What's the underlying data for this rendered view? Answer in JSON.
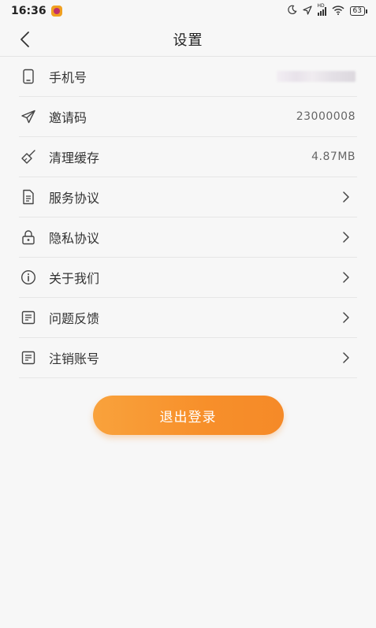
{
  "status_bar": {
    "time": "16:36",
    "network": "HD",
    "battery": "63"
  },
  "header": {
    "title": "设置"
  },
  "settings": [
    {
      "label": "手机号",
      "value": "",
      "icon": "phone-icon",
      "has_chevron": false,
      "blurred": true
    },
    {
      "label": "邀请码",
      "value": "23000008",
      "icon": "send-icon",
      "has_chevron": false
    },
    {
      "label": "清理缓存",
      "value": "4.87MB",
      "icon": "broom-icon",
      "has_chevron": false
    },
    {
      "label": "服务协议",
      "value": "",
      "icon": "document-icon",
      "has_chevron": true
    },
    {
      "label": "隐私协议",
      "value": "",
      "icon": "lock-icon",
      "has_chevron": true
    },
    {
      "label": "关于我们",
      "value": "",
      "icon": "info-icon",
      "has_chevron": true
    },
    {
      "label": "问题反馈",
      "value": "",
      "icon": "feedback-icon",
      "has_chevron": true
    },
    {
      "label": "注销账号",
      "value": "",
      "icon": "note-icon",
      "has_chevron": true
    }
  ],
  "logout": {
    "label": "退出登录"
  },
  "colors": {
    "accent": "#f7902b",
    "background": "#f7f7f7",
    "divider": "#e6e6e6"
  }
}
